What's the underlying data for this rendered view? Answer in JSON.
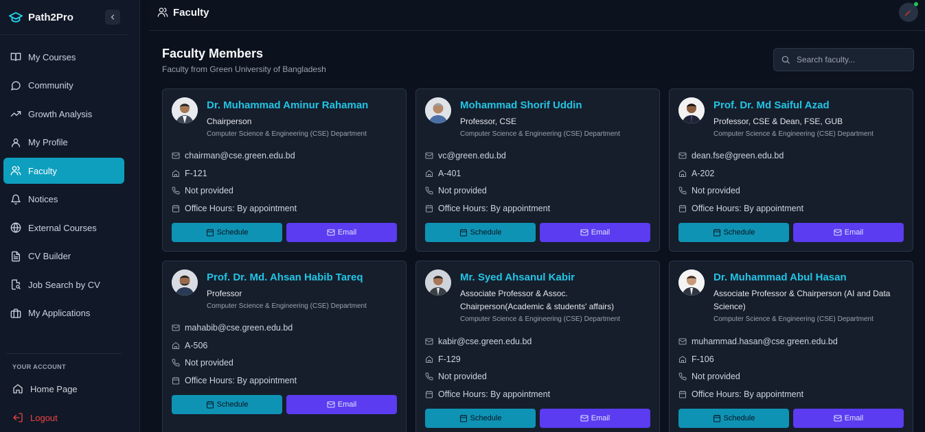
{
  "app": {
    "name": "Path2Pro"
  },
  "sidebar": {
    "items": [
      {
        "label": "My Courses",
        "icon": "book-icon"
      },
      {
        "label": "Community",
        "icon": "chat-icon"
      },
      {
        "label": "Growth Analysis",
        "icon": "trend-icon"
      },
      {
        "label": "My Profile",
        "icon": "user-icon"
      },
      {
        "label": "Faculty",
        "icon": "users-icon",
        "active": true
      },
      {
        "label": "Notices",
        "icon": "bell-icon"
      },
      {
        "label": "External Courses",
        "icon": "globe-icon"
      },
      {
        "label": "CV Builder",
        "icon": "document-icon"
      },
      {
        "label": "Job Search by CV",
        "icon": "file-search-icon"
      },
      {
        "label": "My Applications",
        "icon": "briefcase-icon"
      }
    ],
    "account_label": "YOUR ACCOUNT",
    "home": "Home Page",
    "logout": "Logout"
  },
  "header": {
    "title": "Faculty"
  },
  "main": {
    "title": "Faculty Members",
    "subtitle": "Faculty from Green University of Bangladesh",
    "search_placeholder": "Search faculty..."
  },
  "buttons": {
    "schedule": "Schedule",
    "email": "Email"
  },
  "faculty": [
    {
      "name": "Dr. Muhammad Aminur Rahaman",
      "title": "Chairperson",
      "department": "Computer Science & Engineering (CSE) Department",
      "email": "chairman@cse.green.edu.bd",
      "room": "F-121",
      "phone": "Not provided",
      "hours": "Office Hours: By appointment"
    },
    {
      "name": "Mohammad Shorif Uddin",
      "title": "Professor, CSE",
      "department": "Computer Science & Engineering (CSE) Department",
      "email": "vc@green.edu.bd",
      "room": "A-401",
      "phone": "Not provided",
      "hours": "Office Hours: By appointment"
    },
    {
      "name": "Prof. Dr. Md Saiful Azad",
      "title": "Professor, CSE & Dean, FSE, GUB",
      "department": "Computer Science & Engineering (CSE) Department",
      "email": "dean.fse@green.edu.bd",
      "room": "A-202",
      "phone": "Not provided",
      "hours": "Office Hours: By appointment"
    },
    {
      "name": "Prof. Dr. Md. Ahsan Habib Tareq",
      "title": "Professor",
      "department": "Computer Science & Engineering (CSE) Department",
      "email": "mahabib@cse.green.edu.bd",
      "room": "A-506",
      "phone": "Not provided",
      "hours": "Office Hours: By appointment"
    },
    {
      "name": "Mr. Syed Ahsanul Kabir",
      "title": "Associate Professor & Assoc. Chairperson(Academic & students' affairs)",
      "department": "Computer Science & Engineering (CSE) Department",
      "email": "kabir@cse.green.edu.bd",
      "room": "F-129",
      "phone": "Not provided",
      "hours": "Office Hours: By appointment"
    },
    {
      "name": "Dr. Muhammad Abul Hasan",
      "title": "Associate Professor & Chairperson (AI and Data Science)",
      "department": "Computer Science & Engineering (CSE) Department",
      "email": "muhammad.hasan@cse.green.edu.bd",
      "room": "F-106",
      "phone": "Not provided",
      "hours": "Office Hours: By appointment"
    }
  ],
  "colors": {
    "accent": "#0e9fbf",
    "name": "#22c5e5",
    "email_button": "#5b3cf0",
    "online": "#22c55e"
  }
}
